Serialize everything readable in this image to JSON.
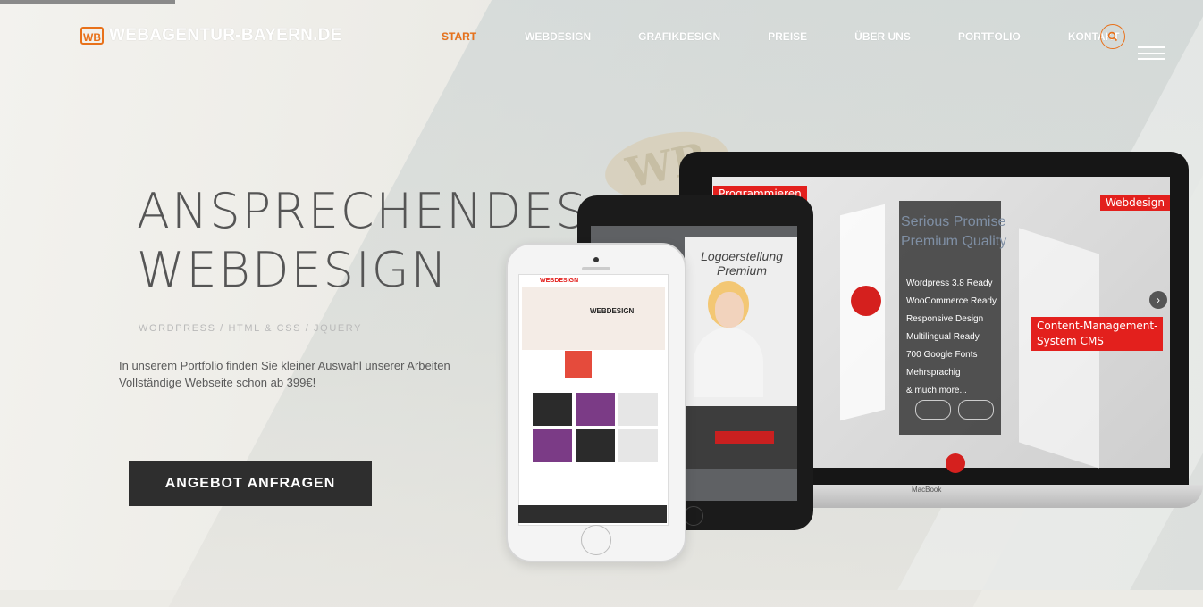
{
  "brand": {
    "logo_mark": "WB",
    "name": "WEBAGENTUR-BAYERN.DE"
  },
  "nav": {
    "items": [
      {
        "label": "START",
        "active": true
      },
      {
        "label": "WEBDESIGN",
        "active": false
      },
      {
        "label": "GRAFIKDESIGN",
        "active": false
      },
      {
        "label": "PREISE",
        "active": false
      },
      {
        "label": "ÜBER UNS",
        "active": false
      },
      {
        "label": "PORTFOLIO",
        "active": false
      },
      {
        "label": "KONTAKT",
        "active": false
      }
    ],
    "search_icon": "search-icon",
    "menu_icon": "hamburger-menu-icon"
  },
  "hero": {
    "title_line1": "ANSPRECHENDES",
    "title_line2": "WEBDESIGN",
    "tech": "WORDPRESS / HTML & CSS / JQUERY",
    "desc_line1": "In unserem Portfolio finden Sie kleiner Auswahl unserer Arbeiten",
    "desc_line2": "Vollständige Webseite schon ab 399€!",
    "cta": "ANGEBOT ANFRAGEN"
  },
  "devices": {
    "macbook": {
      "label": "MacBook",
      "tag_programmieren": "Programmieren",
      "tag_webdesign": "Webdesign",
      "tag_cms_line1": "Content-Management-",
      "tag_cms_line2": "System CMS",
      "promise_line1": "Serious Promise",
      "promise_line2": "Premium Quality",
      "features": [
        "Wordpress 3.8 Ready",
        "WooCommerce Ready",
        "Responsive Design",
        "Multilingual Ready",
        "700 Google Fonts",
        "Mehrsprachig",
        "& much more..."
      ]
    },
    "ipad": {
      "title_line1": "Logoerstellung",
      "title_line2": "Premium"
    },
    "iphone": {
      "brand": "WEBDESIGN",
      "hero_label": "WEBDESIGN"
    }
  },
  "colors": {
    "accent": "#e8711a",
    "cta_bg": "#2e2e2e",
    "tag_red": "#e3201d"
  }
}
